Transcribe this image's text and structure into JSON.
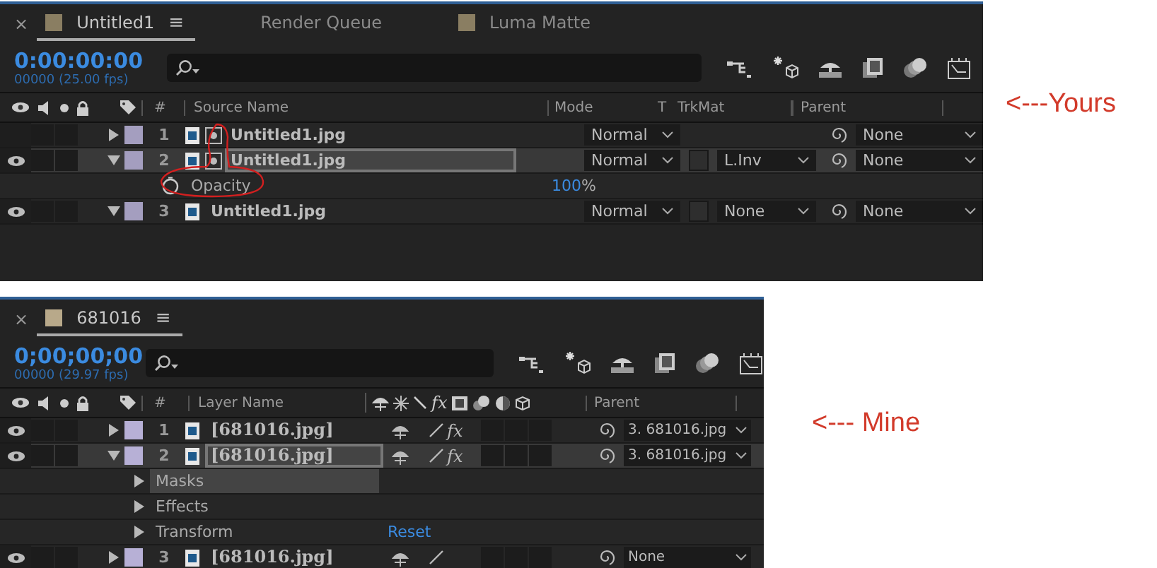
{
  "panels": [
    {
      "kind": "trkmat",
      "close": "×",
      "menu": "≡",
      "tabs": [
        {
          "label": "Untitled1",
          "selected": true,
          "color": "#8a7e62"
        },
        {
          "label": "Render Queue",
          "selected": false
        },
        {
          "label": "Luma Matte",
          "selected": false,
          "color": "#8a7e62"
        }
      ],
      "timecode": "0:00:00:00",
      "fps": "00000 (25.00 fps)",
      "columns": {
        "number": "#",
        "name": "Source Name",
        "mode": "Mode",
        "t": "T",
        "trkmat": "TrkMat",
        "parent": "Parent"
      },
      "rows": [
        {
          "kind": "layer",
          "number": "1",
          "name": "Untitled1.jpg",
          "visible": false,
          "expanded": false,
          "selected": false,
          "color": "#a49ebf",
          "matte_icon": true,
          "mode": "Normal",
          "parent": "None"
        },
        {
          "kind": "layer",
          "number": "2",
          "name": "Untitled1.jpg",
          "visible": true,
          "expanded": true,
          "selected": true,
          "color": "#a49ebf",
          "matte_icon": true,
          "mode": "Normal",
          "trkmat": "L.Inv",
          "parent": "None"
        },
        {
          "kind": "property",
          "name": "Opacity",
          "value": "100",
          "unit": "%",
          "selected": false
        },
        {
          "kind": "layer",
          "number": "3",
          "name": "Untitled1.jpg",
          "visible": true,
          "expanded": true,
          "selected": false,
          "color": "#a49ebf",
          "matte_icon": false,
          "mode": "Normal",
          "trkmat": "None",
          "parent": "None"
        }
      ],
      "annotation": "<---Yours"
    },
    {
      "kind": "switches",
      "close": "×",
      "menu": "≡",
      "tabs": [
        {
          "label": "681016",
          "selected": true,
          "color": "#b8a98a"
        }
      ],
      "timecode": "0;00;00;00",
      "fps": "00000 (29.97 fps)",
      "columns": {
        "number": "#",
        "name": "Layer Name",
        "fx": "fx",
        "parent": "Parent"
      },
      "rows": [
        {
          "kind": "layer",
          "number": "1",
          "name": "[681016.jpg]",
          "visible": true,
          "expanded": false,
          "selected": false,
          "color": "#b7b0d6",
          "fx": "fx",
          "parent": "3. 681016.jpg"
        },
        {
          "kind": "layer",
          "number": "2",
          "name": "[681016.jpg]",
          "visible": true,
          "expanded": true,
          "selected": true,
          "color": "#b7b0d6",
          "fx": "fx",
          "parent": "3. 681016.jpg"
        },
        {
          "kind": "group",
          "name": "Masks",
          "expanded": false,
          "selected": true
        },
        {
          "kind": "group",
          "name": "Effects",
          "expanded": false,
          "selected": false
        },
        {
          "kind": "group",
          "name": "Transform",
          "expanded": false,
          "selected": false,
          "value": "Reset"
        },
        {
          "kind": "layer",
          "number": "3",
          "name": "[681016.jpg]",
          "visible": true,
          "expanded": false,
          "selected": false,
          "color": "#b7b0d6",
          "parent": "None"
        }
      ],
      "annotation": "<--- Mine"
    }
  ]
}
